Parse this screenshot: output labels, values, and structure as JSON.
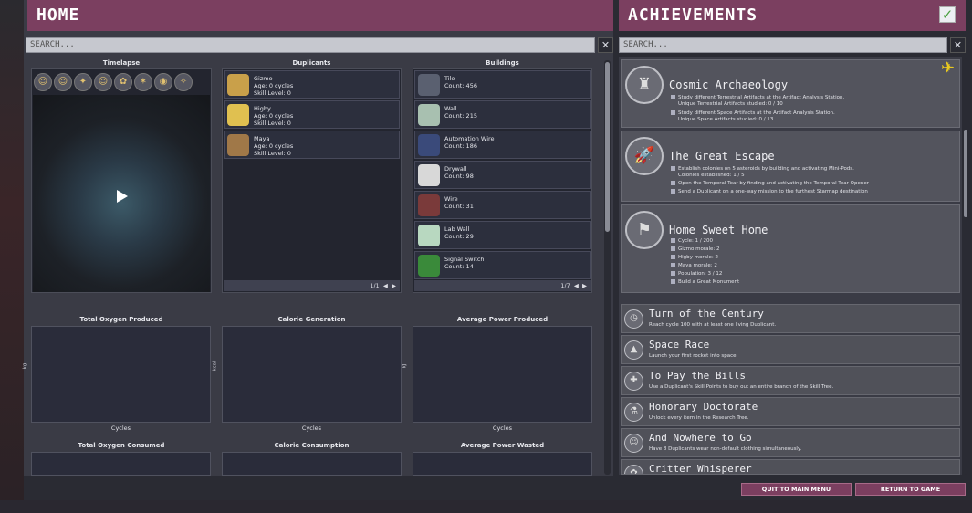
{
  "home": {
    "title": "HOME",
    "search_placeholder": "SEARCH...",
    "close": "✕",
    "timelapse_title": "Timelapse",
    "duplicants_title": "Duplicants",
    "buildings_title": "Buildings",
    "duplicants": [
      {
        "name": "Gizmo",
        "age": "Age: 0 cycles",
        "skill": "Skill Level: 0"
      },
      {
        "name": "Higby",
        "age": "Age: 0 cycles",
        "skill": "Skill Level: 0"
      },
      {
        "name": "Maya",
        "age": "Age: 0 cycles",
        "skill": "Skill Level: 0"
      }
    ],
    "duplicants_pager": "1/1",
    "buildings": [
      {
        "name": "Tile",
        "count": "Count: 456"
      },
      {
        "name": "Wall",
        "count": "Count: 215"
      },
      {
        "name": "Automation Wire",
        "count": "Count: 186"
      },
      {
        "name": "Drywall",
        "count": "Count: 98"
      },
      {
        "name": "Wire",
        "count": "Count: 31"
      },
      {
        "name": "Lab Wall",
        "count": "Count: 29"
      },
      {
        "name": "Signal Switch",
        "count": "Count: 14"
      }
    ],
    "buildings_pager": "1/7",
    "charts": [
      {
        "title": "Total Oxygen Produced",
        "ylabel": "kg",
        "xlabel": "Cycles"
      },
      {
        "title": "Calorie Generation",
        "ylabel": "kcal",
        "xlabel": "Cycles"
      },
      {
        "title": "Average Power Produced",
        "ylabel": "kJ",
        "xlabel": "Cycles"
      }
    ],
    "charts_row2": [
      {
        "title": "Total Oxygen Consumed"
      },
      {
        "title": "Calorie Consumption"
      },
      {
        "title": "Average Power Wasted"
      }
    ]
  },
  "achievements": {
    "title": "ACHIEVEMENTS",
    "check": "✓",
    "search_placeholder": "SEARCH...",
    "close": "✕",
    "big": [
      {
        "title": "Cosmic Archaeology",
        "reqs": [
          "Study different Terrestrial Artifacts at the Artifact Analysis Station.",
          "Unique Terrestrial Artifacts studied: 0 / 10",
          "Study different Space Artifacts at the Artifact Analysis Station.",
          "Unique Space Artifacts studied: 0 / 13"
        ]
      },
      {
        "title": "The Great Escape",
        "reqs": [
          "Establish colonies on 5 asteroids by building and activating Mini-Pods.",
          "Colonies established: 1 / 5",
          "Open the Temporal Tear by finding and activating the Temporal Tear Opener",
          "Send a Duplicant on a one-way mission to the furthest Starmap destination"
        ]
      },
      {
        "title": "Home Sweet Home",
        "reqs": [
          "Cycle: 1 / 200",
          "Gizmo morale: 2",
          "Higby morale: 2",
          "Maya morale: 2",
          "Population: 3 / 12",
          "Build a Great Monument"
        ]
      }
    ],
    "divider": "—",
    "small": [
      {
        "title": "Turn of the Century",
        "desc": "Reach cycle 100 with at least one living Duplicant."
      },
      {
        "title": "Space Race",
        "desc": "Launch your first rocket into space."
      },
      {
        "title": "To Pay the Bills",
        "desc": "Use a Duplicant's Skill Points to buy out an entire branch of the Skill Tree."
      },
      {
        "title": "Honorary Doctorate",
        "desc": "Unlock every item in the Research Tree."
      },
      {
        "title": "And Nowhere to Go",
        "desc": "Have 8 Duplicants wear non-default clothing simultaneously."
      },
      {
        "title": "Critter Whisperer",
        "desc": ""
      }
    ]
  },
  "footer": {
    "quit": "QUIT TO MAIN MENU",
    "return": "RETURN TO GAME"
  },
  "colors": {
    "header": "#7b3f60",
    "panel": "#3a3b45",
    "row": "#2c2f3d"
  }
}
